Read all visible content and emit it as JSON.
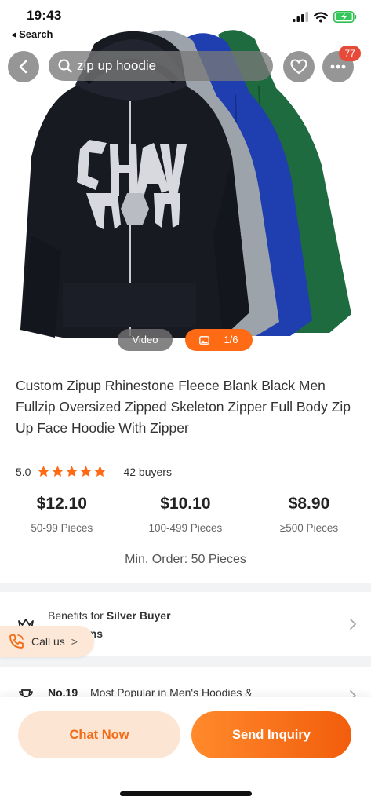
{
  "status_bar": {
    "time": "19:43",
    "back_to_app": "◂ Search"
  },
  "nav": {
    "search_query": "zip up hoodie",
    "notification_count": "77"
  },
  "media": {
    "video_label": "Video",
    "photo_counter": "1/6"
  },
  "product": {
    "title": "Custom Zipup Rhinestone Fleece Blank Black Men Fullzip Oversized Zipped Skeleton Zipper Full Body Zip Up Face Hoodie With Zipper",
    "rating": "5.0",
    "stars": 5,
    "buyers": "42 buyers",
    "tiers": [
      {
        "price": "$12.10",
        "qty": "50-99 Pieces"
      },
      {
        "price": "$10.10",
        "qty": "100-499 Pieces"
      },
      {
        "price": "$8.90",
        "qty": "≥500 Pieces"
      }
    ],
    "min_order": "Min. Order: 50 Pieces"
  },
  "benefits": {
    "prefix": "Benefits for",
    "tier": "Silver Buyer",
    "coupons": "0 coupons"
  },
  "ranking": {
    "rank": "No.19",
    "text": "Most Popular in Men's Hoodies &"
  },
  "call_us": {
    "label": "Call us",
    "arrow": ">"
  },
  "actions": {
    "chat": "Chat Now",
    "inquiry": "Send Inquiry"
  },
  "colors": {
    "accent": "#ff6a14",
    "star": "#ff6a14",
    "badge": "#e84a3a"
  }
}
